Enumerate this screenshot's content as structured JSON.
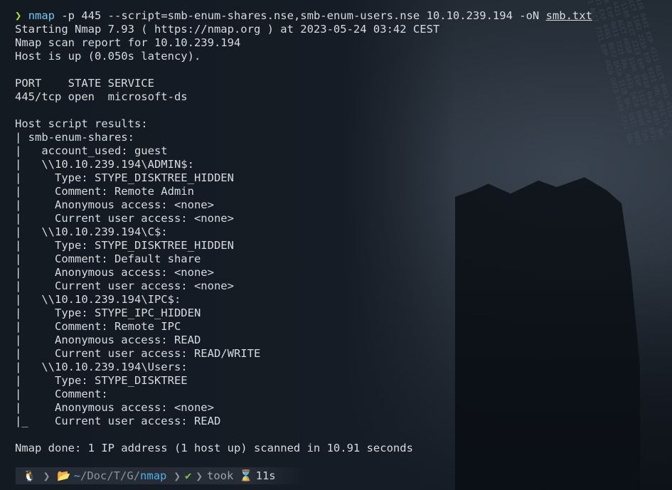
{
  "command": {
    "prompt_symbol": "❯",
    "program": "nmap",
    "args": " -p 445 --script=smb-enum-shares.nse,smb-enum-users.nse 10.10.239.194 -oN ",
    "output_file": "smb.txt"
  },
  "output_lines": [
    "Starting Nmap 7.93 ( https://nmap.org ) at 2023-05-24 03:42 CEST",
    "Nmap scan report for 10.10.239.194",
    "Host is up (0.050s latency).",
    "",
    "PORT    STATE SERVICE",
    "445/tcp open  microsoft-ds",
    "",
    "Host script results:",
    "| smb-enum-shares:",
    "|   account_used: guest",
    "|   \\\\10.10.239.194\\ADMIN$:",
    "|     Type: STYPE_DISKTREE_HIDDEN",
    "|     Comment: Remote Admin",
    "|     Anonymous access: <none>",
    "|     Current user access: <none>",
    "|   \\\\10.10.239.194\\C$:",
    "|     Type: STYPE_DISKTREE_HIDDEN",
    "|     Comment: Default share",
    "|     Anonymous access: <none>",
    "|     Current user access: <none>",
    "|   \\\\10.10.239.194\\IPC$:",
    "|     Type: STYPE_IPC_HIDDEN",
    "|     Comment: Remote IPC",
    "|     Anonymous access: READ",
    "|     Current user access: READ/WRITE",
    "|   \\\\10.10.239.194\\Users:",
    "|     Type: STYPE_DISKTREE",
    "|     Comment:",
    "|     Anonymous access: <none>",
    "|_    Current user access: READ",
    "",
    "Nmap done: 1 IP address (1 host up) scanned in 10.91 seconds"
  ],
  "statusbar": {
    "os_icon": "linux-tux-icon",
    "os_glyph": "🐧",
    "folder_icon": "folder-open-icon",
    "folder_glyph": "📂",
    "path_home": "~",
    "path_parts": [
      "Doc",
      "T",
      "G"
    ],
    "path_current": "nmap",
    "status_glyph": "✔",
    "took_label": "took",
    "hourglass_glyph": "⌛",
    "duration": "11s"
  },
  "colors": {
    "prompt_green": "#a6e22e",
    "command_blue": "#76c5ef",
    "path_blue": "#4fb0e6",
    "check_green": "#7cc14e",
    "text": "#d7dbe0"
  }
}
